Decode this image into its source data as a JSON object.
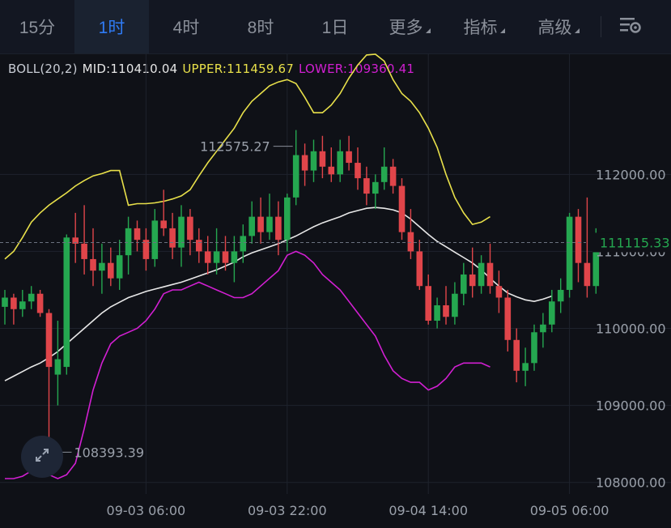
{
  "toolbar": {
    "tabs": [
      {
        "label": "15分",
        "active": false,
        "caret": false
      },
      {
        "label": "1时",
        "active": true,
        "caret": false
      },
      {
        "label": "4时",
        "active": false,
        "caret": false
      },
      {
        "label": "8时",
        "active": false,
        "caret": false
      },
      {
        "label": "1日",
        "active": false,
        "caret": false
      },
      {
        "label": "更多",
        "active": false,
        "caret": true
      },
      {
        "label": "指标",
        "active": false,
        "caret": true
      },
      {
        "label": "高级",
        "active": false,
        "caret": true
      }
    ],
    "settings_icon": "chart-settings-icon"
  },
  "indicator": {
    "name": "BOLL(20,2)",
    "mid": "MID:110410.04",
    "upper": "UPPER:111459.67",
    "lower": "LOWER:109360.41"
  },
  "colors": {
    "background": "#0f1117",
    "up": "#25a750",
    "down": "#e0454a",
    "mid": "#e8e8e8",
    "upper": "#e8e04a",
    "lower": "#d21fd2",
    "grid": "#1e232d",
    "active_tab": "#2f7bf5",
    "price_tag": "#25a750"
  },
  "chart_data": {
    "type": "candlestick",
    "y_ticks": [
      "112000.00",
      "111000.00",
      "110000.00",
      "109000.00",
      "108000.00"
    ],
    "y_tick_values": [
      112000,
      111000,
      110000,
      109000,
      108000
    ],
    "x_ticks": [
      "09-03 06:00",
      "09-03 22:00",
      "09-04 14:00",
      "09-05 06:00"
    ],
    "x_tick_index": [
      16,
      32,
      48,
      64
    ],
    "ylim": [
      107850,
      113570
    ],
    "current_price": "111115.33",
    "current_value": 111115.33,
    "high_label": "112575.27",
    "high_value": 112575.27,
    "high_index": 33,
    "low_label": "108393.39",
    "low_value": 108393.39,
    "low_index": 5,
    "candles": [
      [
        110280,
        110500,
        110050,
        110400
      ],
      [
        110400,
        110450,
        110050,
        110250
      ],
      [
        110250,
        110500,
        110150,
        110350
      ],
      [
        110350,
        110550,
        110250,
        110450
      ],
      [
        110450,
        110500,
        110150,
        110200
      ],
      [
        110200,
        110250,
        108393.39,
        109500
      ],
      [
        109400,
        110100,
        109000,
        109600
      ],
      [
        109500,
        111220,
        109400,
        111180
      ],
      [
        111180,
        111500,
        110850,
        111100
      ],
      [
        111100,
        111600,
        110700,
        110900
      ],
      [
        110900,
        111300,
        110550,
        110750
      ],
      [
        110750,
        111100,
        110450,
        110850
      ],
      [
        110850,
        111050,
        110550,
        110650
      ],
      [
        110650,
        111150,
        110500,
        110950
      ],
      [
        110950,
        111450,
        110700,
        111300
      ],
      [
        111300,
        111400,
        111000,
        111150
      ],
      [
        111150,
        111300,
        110750,
        110900
      ],
      [
        110900,
        111550,
        110800,
        111400
      ],
      [
        111400,
        111800,
        111200,
        111300
      ],
      [
        111300,
        111500,
        110900,
        111050
      ],
      [
        111050,
        111600,
        110800,
        111450
      ],
      [
        111450,
        111550,
        110950,
        111150
      ],
      [
        111150,
        111300,
        110850,
        111000
      ],
      [
        111000,
        111200,
        110700,
        110850
      ],
      [
        110850,
        111300,
        110700,
        111000
      ],
      [
        111000,
        111200,
        110750,
        110850
      ],
      [
        110850,
        111200,
        110600,
        111000
      ],
      [
        111000,
        111350,
        110850,
        111200
      ],
      [
        111200,
        111650,
        111100,
        111450
      ],
      [
        111450,
        111700,
        111100,
        111250
      ],
      [
        111250,
        111750,
        111150,
        111450
      ],
      [
        111450,
        111650,
        110950,
        111150
      ],
      [
        111150,
        111750,
        111000,
        111700
      ],
      [
        111700,
        112575.27,
        111600,
        112250
      ],
      [
        112250,
        112400,
        111850,
        112050
      ],
      [
        112050,
        112450,
        111900,
        112300
      ],
      [
        112300,
        112500,
        111950,
        112100
      ],
      [
        112100,
        112350,
        111900,
        112000
      ],
      [
        112000,
        112450,
        111900,
        112300
      ],
      [
        112300,
        112500,
        112050,
        112150
      ],
      [
        112150,
        112350,
        111800,
        111950
      ],
      [
        111950,
        112100,
        111600,
        111750
      ],
      [
        111750,
        112000,
        111550,
        111900
      ],
      [
        111900,
        112350,
        111800,
        112100
      ],
      [
        112100,
        112200,
        111750,
        111850
      ],
      [
        111850,
        111950,
        111150,
        111250
      ],
      [
        111250,
        111550,
        110900,
        111000
      ],
      [
        111000,
        111150,
        110500,
        110550
      ],
      [
        110550,
        110700,
        110050,
        110100
      ],
      [
        110100,
        110400,
        110000,
        110300
      ],
      [
        110300,
        110550,
        110050,
        110150
      ],
      [
        110150,
        110600,
        110050,
        110450
      ],
      [
        110450,
        110850,
        110300,
        110700
      ],
      [
        110700,
        111050,
        110400,
        110550
      ],
      [
        110550,
        110950,
        110450,
        110850
      ],
      [
        110850,
        111100,
        110450,
        110550
      ],
      [
        110550,
        110750,
        110200,
        110400
      ],
      [
        110400,
        110500,
        109700,
        109850
      ],
      [
        109850,
        110000,
        109300,
        109450
      ],
      [
        109450,
        109750,
        109250,
        109550
      ],
      [
        109550,
        110050,
        109450,
        109950
      ],
      [
        109950,
        110200,
        109750,
        110050
      ],
      [
        110050,
        110500,
        109950,
        110350
      ],
      [
        110350,
        110650,
        110200,
        110500
      ],
      [
        110500,
        111500,
        110400,
        111450
      ],
      [
        111450,
        111550,
        110600,
        110850
      ],
      [
        110850,
        111700,
        110400,
        110550
      ],
      [
        110550,
        111300,
        110450,
        111115.33
      ]
    ],
    "boll_mid": [
      109320,
      109380,
      109440,
      109500,
      109550,
      109620,
      109700,
      109800,
      109900,
      110000,
      110100,
      110200,
      110280,
      110340,
      110400,
      110440,
      110480,
      110510,
      110540,
      110570,
      110600,
      110640,
      110680,
      110720,
      110760,
      110810,
      110860,
      110930,
      110980,
      111020,
      111060,
      111100,
      111150,
      111200,
      111260,
      111320,
      111370,
      111410,
      111450,
      111500,
      111530,
      111560,
      111570,
      111560,
      111540,
      111500,
      111420,
      111320,
      111220,
      111130,
      111060,
      110990,
      110920,
      110850,
      110760,
      110650,
      110550,
      110460,
      110410,
      110370,
      110350,
      110380,
      110420
    ],
    "boll_upper": [
      110900,
      111000,
      111180,
      111380,
      111500,
      111600,
      111680,
      111760,
      111850,
      111920,
      111980,
      112010,
      112050,
      112050,
      111600,
      111620,
      111620,
      111630,
      111650,
      111680,
      111720,
      111800,
      111980,
      112150,
      112300,
      112450,
      112600,
      112800,
      112950,
      113050,
      113150,
      113200,
      113230,
      113180,
      113000,
      112800,
      112800,
      112900,
      113050,
      113250,
      113420,
      113550,
      113560,
      113470,
      113230,
      113050,
      112950,
      112800,
      112600,
      112350,
      112000,
      111700,
      111500,
      111350,
      111380,
      111450
    ],
    "boll_upper_start": 0,
    "boll_lower": [
      108050,
      108050,
      108080,
      108150,
      108150,
      108100,
      108050,
      108100,
      108250,
      108700,
      109200,
      109550,
      109800,
      109900,
      109950,
      110000,
      110100,
      110250,
      110450,
      110500,
      110500,
      110550,
      110600,
      110550,
      110500,
      110450,
      110400,
      110400,
      110450,
      110550,
      110650,
      110750,
      110950,
      111000,
      110950,
      110850,
      110700,
      110600,
      110500,
      110350,
      110200,
      110050,
      109900,
      109650,
      109450,
      109350,
      109300,
      109300,
      109200,
      109250,
      109350,
      109500,
      109550,
      109550,
      109550,
      109500
    ],
    "boll_lower_start": 0
  }
}
